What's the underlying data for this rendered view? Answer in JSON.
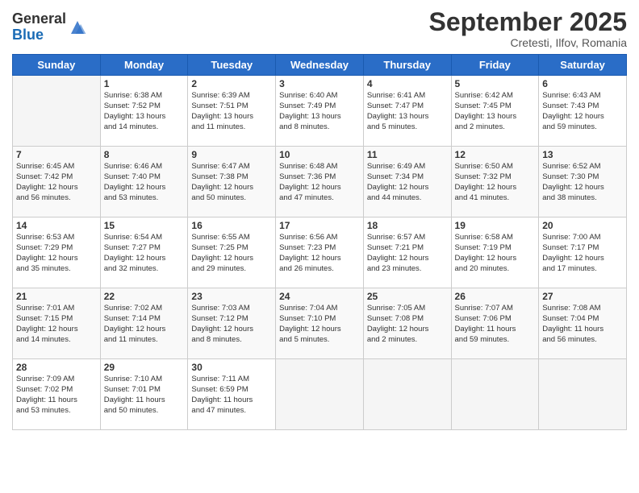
{
  "logo": {
    "general": "General",
    "blue": "Blue"
  },
  "header": {
    "month": "September 2025",
    "location": "Cretesti, Ilfov, Romania"
  },
  "weekdays": [
    "Sunday",
    "Monday",
    "Tuesday",
    "Wednesday",
    "Thursday",
    "Friday",
    "Saturday"
  ],
  "weeks": [
    [
      {
        "day": "",
        "info": ""
      },
      {
        "day": "1",
        "info": "Sunrise: 6:38 AM\nSunset: 7:52 PM\nDaylight: 13 hours\nand 14 minutes."
      },
      {
        "day": "2",
        "info": "Sunrise: 6:39 AM\nSunset: 7:51 PM\nDaylight: 13 hours\nand 11 minutes."
      },
      {
        "day": "3",
        "info": "Sunrise: 6:40 AM\nSunset: 7:49 PM\nDaylight: 13 hours\nand 8 minutes."
      },
      {
        "day": "4",
        "info": "Sunrise: 6:41 AM\nSunset: 7:47 PM\nDaylight: 13 hours\nand 5 minutes."
      },
      {
        "day": "5",
        "info": "Sunrise: 6:42 AM\nSunset: 7:45 PM\nDaylight: 13 hours\nand 2 minutes."
      },
      {
        "day": "6",
        "info": "Sunrise: 6:43 AM\nSunset: 7:43 PM\nDaylight: 12 hours\nand 59 minutes."
      }
    ],
    [
      {
        "day": "7",
        "info": "Sunrise: 6:45 AM\nSunset: 7:42 PM\nDaylight: 12 hours\nand 56 minutes."
      },
      {
        "day": "8",
        "info": "Sunrise: 6:46 AM\nSunset: 7:40 PM\nDaylight: 12 hours\nand 53 minutes."
      },
      {
        "day": "9",
        "info": "Sunrise: 6:47 AM\nSunset: 7:38 PM\nDaylight: 12 hours\nand 50 minutes."
      },
      {
        "day": "10",
        "info": "Sunrise: 6:48 AM\nSunset: 7:36 PM\nDaylight: 12 hours\nand 47 minutes."
      },
      {
        "day": "11",
        "info": "Sunrise: 6:49 AM\nSunset: 7:34 PM\nDaylight: 12 hours\nand 44 minutes."
      },
      {
        "day": "12",
        "info": "Sunrise: 6:50 AM\nSunset: 7:32 PM\nDaylight: 12 hours\nand 41 minutes."
      },
      {
        "day": "13",
        "info": "Sunrise: 6:52 AM\nSunset: 7:30 PM\nDaylight: 12 hours\nand 38 minutes."
      }
    ],
    [
      {
        "day": "14",
        "info": "Sunrise: 6:53 AM\nSunset: 7:29 PM\nDaylight: 12 hours\nand 35 minutes."
      },
      {
        "day": "15",
        "info": "Sunrise: 6:54 AM\nSunset: 7:27 PM\nDaylight: 12 hours\nand 32 minutes."
      },
      {
        "day": "16",
        "info": "Sunrise: 6:55 AM\nSunset: 7:25 PM\nDaylight: 12 hours\nand 29 minutes."
      },
      {
        "day": "17",
        "info": "Sunrise: 6:56 AM\nSunset: 7:23 PM\nDaylight: 12 hours\nand 26 minutes."
      },
      {
        "day": "18",
        "info": "Sunrise: 6:57 AM\nSunset: 7:21 PM\nDaylight: 12 hours\nand 23 minutes."
      },
      {
        "day": "19",
        "info": "Sunrise: 6:58 AM\nSunset: 7:19 PM\nDaylight: 12 hours\nand 20 minutes."
      },
      {
        "day": "20",
        "info": "Sunrise: 7:00 AM\nSunset: 7:17 PM\nDaylight: 12 hours\nand 17 minutes."
      }
    ],
    [
      {
        "day": "21",
        "info": "Sunrise: 7:01 AM\nSunset: 7:15 PM\nDaylight: 12 hours\nand 14 minutes."
      },
      {
        "day": "22",
        "info": "Sunrise: 7:02 AM\nSunset: 7:14 PM\nDaylight: 12 hours\nand 11 minutes."
      },
      {
        "day": "23",
        "info": "Sunrise: 7:03 AM\nSunset: 7:12 PM\nDaylight: 12 hours\nand 8 minutes."
      },
      {
        "day": "24",
        "info": "Sunrise: 7:04 AM\nSunset: 7:10 PM\nDaylight: 12 hours\nand 5 minutes."
      },
      {
        "day": "25",
        "info": "Sunrise: 7:05 AM\nSunset: 7:08 PM\nDaylight: 12 hours\nand 2 minutes."
      },
      {
        "day": "26",
        "info": "Sunrise: 7:07 AM\nSunset: 7:06 PM\nDaylight: 11 hours\nand 59 minutes."
      },
      {
        "day": "27",
        "info": "Sunrise: 7:08 AM\nSunset: 7:04 PM\nDaylight: 11 hours\nand 56 minutes."
      }
    ],
    [
      {
        "day": "28",
        "info": "Sunrise: 7:09 AM\nSunset: 7:02 PM\nDaylight: 11 hours\nand 53 minutes."
      },
      {
        "day": "29",
        "info": "Sunrise: 7:10 AM\nSunset: 7:01 PM\nDaylight: 11 hours\nand 50 minutes."
      },
      {
        "day": "30",
        "info": "Sunrise: 7:11 AM\nSunset: 6:59 PM\nDaylight: 11 hours\nand 47 minutes."
      },
      {
        "day": "",
        "info": ""
      },
      {
        "day": "",
        "info": ""
      },
      {
        "day": "",
        "info": ""
      },
      {
        "day": "",
        "info": ""
      }
    ]
  ]
}
